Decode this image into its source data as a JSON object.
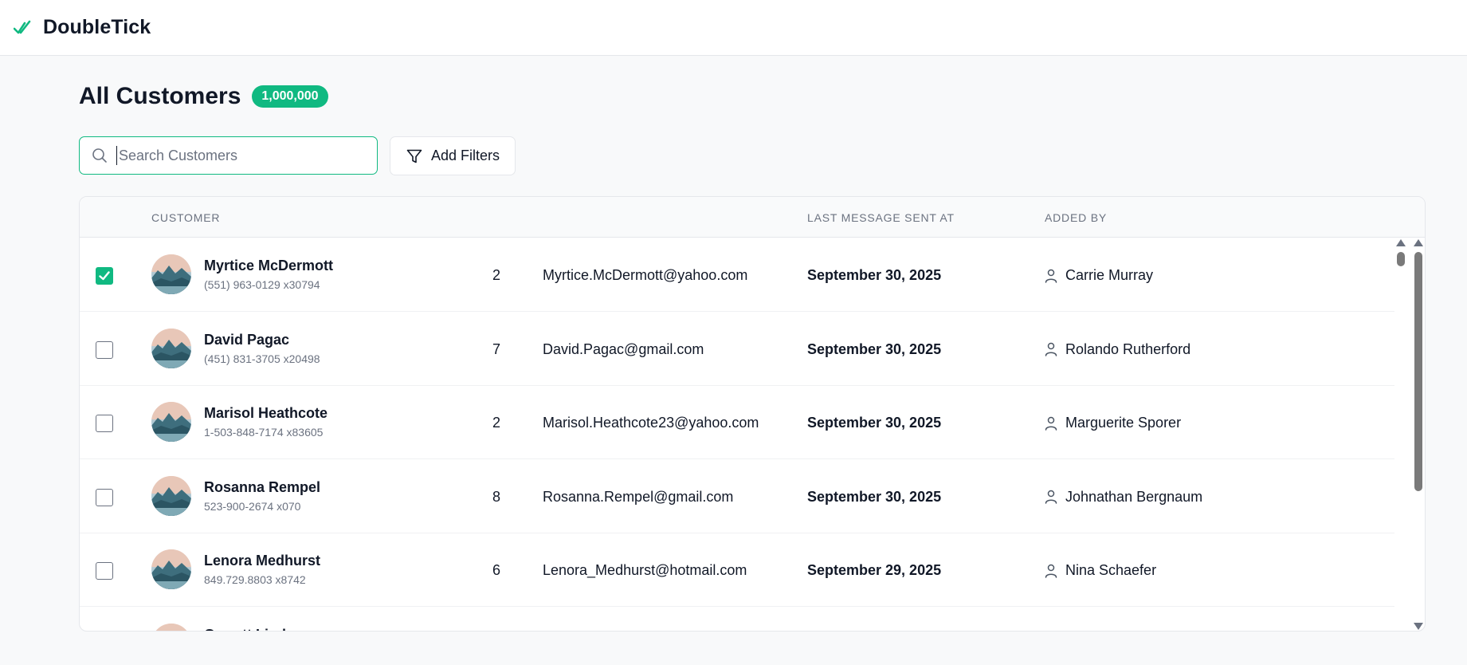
{
  "app": {
    "brand": "DoubleTick"
  },
  "page": {
    "title": "All Customers",
    "count_badge": "1,000,000"
  },
  "search": {
    "placeholder": "Search Customers",
    "value": ""
  },
  "filters": {
    "label": "Add Filters"
  },
  "table": {
    "headers": {
      "customer": "CUSTOMER",
      "last_message": "LAST MESSAGE SENT AT",
      "added_by": "ADDED BY"
    },
    "rows": [
      {
        "checked": true,
        "name": "Myrtice McDermott",
        "phone": "(551) 963-0129 x30794",
        "count": "2",
        "email": "Myrtice.McDermott@yahoo.com",
        "date": "September 30, 2025",
        "added_by": "Carrie Murray"
      },
      {
        "checked": false,
        "name": "David Pagac",
        "phone": "(451) 831-3705 x20498",
        "count": "7",
        "email": "David.Pagac@gmail.com",
        "date": "September 30, 2025",
        "added_by": "Rolando Rutherford"
      },
      {
        "checked": false,
        "name": "Marisol Heathcote",
        "phone": "1-503-848-7174 x83605",
        "count": "2",
        "email": "Marisol.Heathcote23@yahoo.com",
        "date": "September 30, 2025",
        "added_by": "Marguerite Sporer"
      },
      {
        "checked": false,
        "name": "Rosanna Rempel",
        "phone": "523-900-2674 x070",
        "count": "8",
        "email": "Rosanna.Rempel@gmail.com",
        "date": "September 30, 2025",
        "added_by": "Johnathan Bergnaum"
      },
      {
        "checked": false,
        "name": "Lenora Medhurst",
        "phone": "849.729.8803 x8742",
        "count": "6",
        "email": "Lenora_Medhurst@hotmail.com",
        "date": "September 29, 2025",
        "added_by": "Nina Schaefer"
      },
      {
        "checked": false,
        "name": "Garrett Lind",
        "phone": "",
        "count": "",
        "email": "",
        "date": "",
        "added_by": ""
      }
    ]
  },
  "colors": {
    "accent": "#10b981",
    "text": "#111827",
    "muted": "#6b7280"
  },
  "icons": {
    "logo": "double-check-icon",
    "search": "search-icon",
    "filter": "funnel-icon",
    "user": "user-icon",
    "check": "check-icon",
    "avatar": "landscape-avatar"
  }
}
